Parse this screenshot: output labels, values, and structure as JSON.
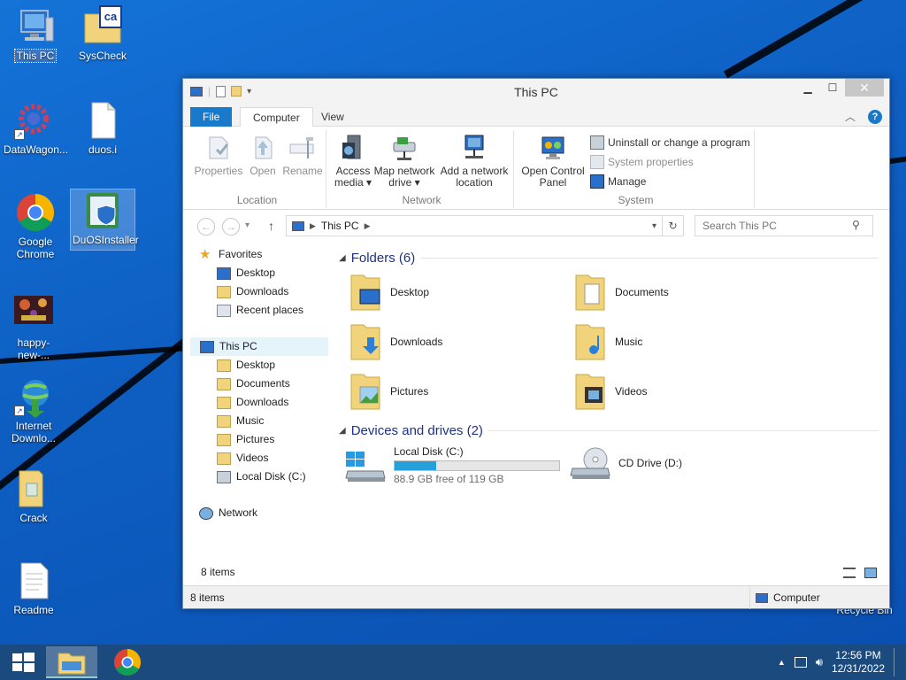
{
  "desktop": {
    "icons": [
      {
        "label": "This PC"
      },
      {
        "label": "SysCheck"
      },
      {
        "label": "DataWagon..."
      },
      {
        "label": "duos.i"
      },
      {
        "label": "Google Chrome"
      },
      {
        "label": "DuOSInstaller"
      },
      {
        "label": "happy-new-..."
      },
      {
        "label": "Internet Downlo..."
      },
      {
        "label": "Crack"
      },
      {
        "label": "Readme"
      },
      {
        "label": "Recycle Bin"
      }
    ],
    "syscheck_badge": "ca"
  },
  "window": {
    "title": "This PC",
    "tabs": {
      "file": "File",
      "computer": "Computer",
      "view": "View"
    },
    "ribbon": {
      "location": {
        "label": "Location",
        "properties": "Properties",
        "open": "Open",
        "rename": "Rename"
      },
      "network": {
        "label": "Network",
        "access_media": "Access media",
        "map_drive": "Map network drive",
        "add_location": "Add a network location"
      },
      "system": {
        "label": "System",
        "control_panel": "Open Control Panel",
        "uninstall": "Uninstall or change a program",
        "system_properties": "System properties",
        "manage": "Manage"
      }
    },
    "address": {
      "path": "This PC",
      "search_placeholder": "Search This PC"
    },
    "nav": {
      "favorites": "Favorites",
      "fav_items": [
        "Desktop",
        "Downloads",
        "Recent places"
      ],
      "this_pc": "This PC",
      "pc_items": [
        "Desktop",
        "Documents",
        "Downloads",
        "Music",
        "Pictures",
        "Videos",
        "Local Disk (C:)"
      ],
      "network": "Network"
    },
    "folders_header": "Folders (6)",
    "folders": [
      "Desktop",
      "Documents",
      "Downloads",
      "Music",
      "Pictures",
      "Videos"
    ],
    "devices_header": "Devices and drives (2)",
    "drives": [
      {
        "name": "Local Disk (C:)",
        "free": "88.9 GB free of 119 GB",
        "used_fraction": 0.253
      },
      {
        "name": "CD Drive (D:)"
      }
    ],
    "items_count": "8 items",
    "status_left": "8 items",
    "status_right": "Computer"
  },
  "taskbar": {
    "time": "12:56 PM",
    "date": "12/31/2022"
  },
  "colors": {
    "accent": "#1979ca",
    "taskbar": "#1a4a7e",
    "folder": "#f0d37a"
  }
}
